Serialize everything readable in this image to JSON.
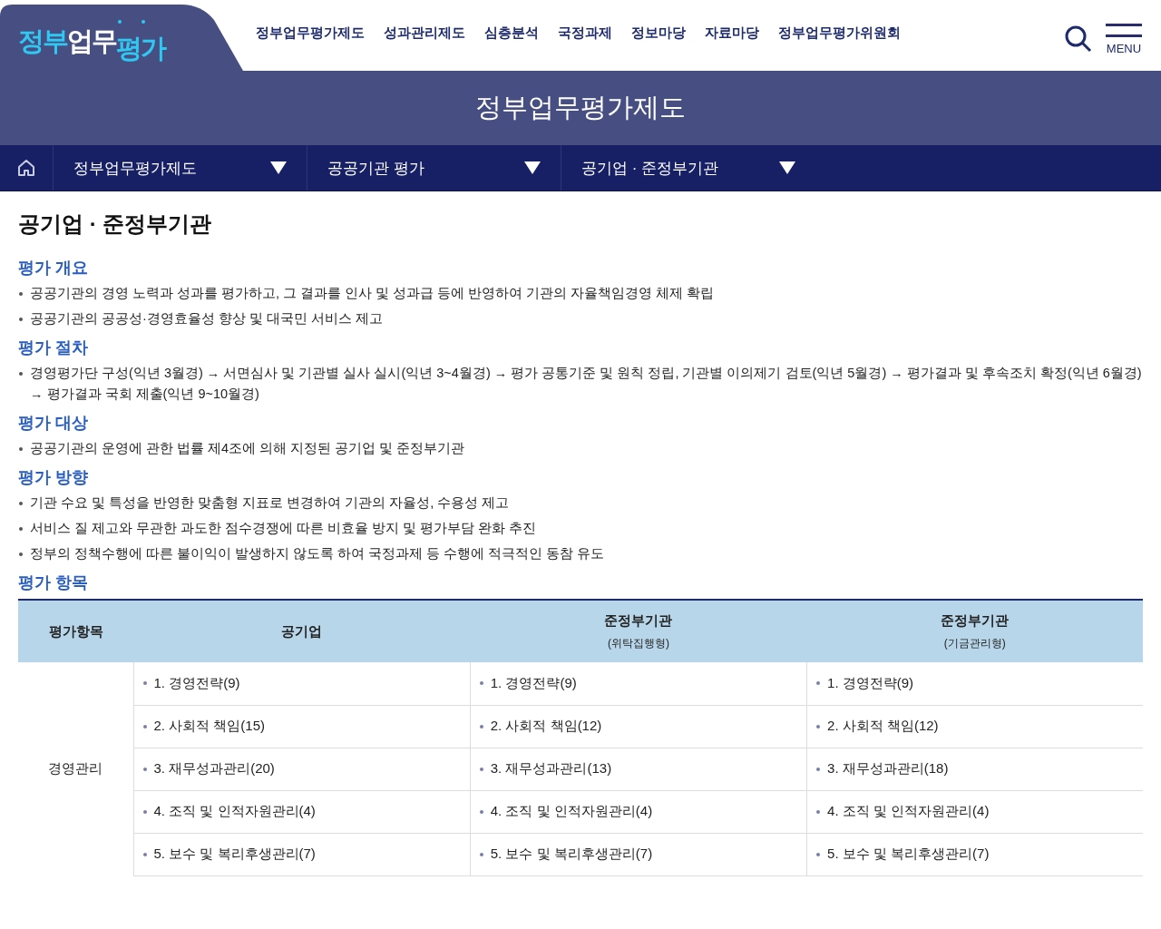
{
  "logo": [
    {
      "text": "정부",
      "color": "#2ec8f2"
    },
    {
      "text": "업무",
      "color": "#ffffff"
    },
    {
      "text": "평가",
      "color": "#2ec8f2"
    }
  ],
  "top_menu": [
    "정부업무평가제도",
    "성과관리제도",
    "심층분석",
    "국정과제",
    "정보마당",
    "자료마당",
    "정부업무평가위원회"
  ],
  "menu_button": "MENU",
  "banner_title": "정부업무평가제도",
  "breadcrumb": [
    "정부업무평가제도",
    "공공기관 평가",
    "공기업 · 준정부기관"
  ],
  "page_title": "공기업 · 준정부기관",
  "sections": [
    {
      "heading": "평가 개요",
      "bullets": [
        "공공기관의 경영 노력과 성과를 평가하고, 그 결과를 인사 및 성과급 등에 반영하여 기관의 자율책임경영 체제 확립",
        "공공기관의 공공성·경영효율성 향상 및 대국민 서비스 제고"
      ]
    },
    {
      "heading": "평가 절차",
      "bullets": [
        "경영평가단 구성(익년 3월경) → 서면심사 및 기관별 실사 실시(익년 3~4월경) → 평가 공통기준 및 원칙 정립, 기관별 이의제기 검토(익년 5월경) → 평가결과 및 후속조치 확정(익년 6월경) → 평가결과 국회 제출(익년 9~10월경)"
      ]
    },
    {
      "heading": "평가 대상",
      "bullets": [
        "공공기관의 운영에 관한 법률 제4조에 의해 지정된 공기업 및 준정부기관"
      ]
    },
    {
      "heading": "평가 방향",
      "bullets": [
        "기관 수요 및 특성을 반영한 맞춤형 지표로 변경하여 기관의 자율성, 수용성 제고",
        "서비스 질 제고와 무관한 과도한 점수경쟁에 따른 비효율 방지 및 평가부담 완화 추진",
        "정부의 정책수행에 따른 불이익이 발생하지 않도록 하여 국정과제 등 수행에 적극적인 동참 유도"
      ]
    },
    {
      "heading": "평가 항목"
    }
  ],
  "table": {
    "columns": [
      {
        "label": "평가항목"
      },
      {
        "label": "공기업"
      },
      {
        "label": "준정부기관",
        "sublabel": "(위탁집행형)"
      },
      {
        "label": "준정부기관",
        "sublabel": "(기금관리형)"
      }
    ],
    "groups": [
      {
        "category": "경영관리",
        "rows": [
          [
            "1. 경영전략(9)",
            "1. 경영전략(9)",
            "1. 경영전략(9)"
          ],
          [
            "2. 사회적 책임(15)",
            "2. 사회적 책임(12)",
            "2. 사회적 책임(12)"
          ],
          [
            "3. 재무성과관리(20)",
            "3. 재무성과관리(13)",
            "3. 재무성과관리(18)"
          ],
          [
            "4. 조직 및 인적자원관리(4)",
            "4. 조직 및 인적자원관리(4)",
            "4. 조직 및 인적자원관리(4)"
          ],
          [
            "5. 보수 및 복리후생관리(7)",
            "5. 보수 및 복리후생관리(7)",
            "5. 보수 및 복리후생관리(7)"
          ]
        ]
      }
    ]
  }
}
